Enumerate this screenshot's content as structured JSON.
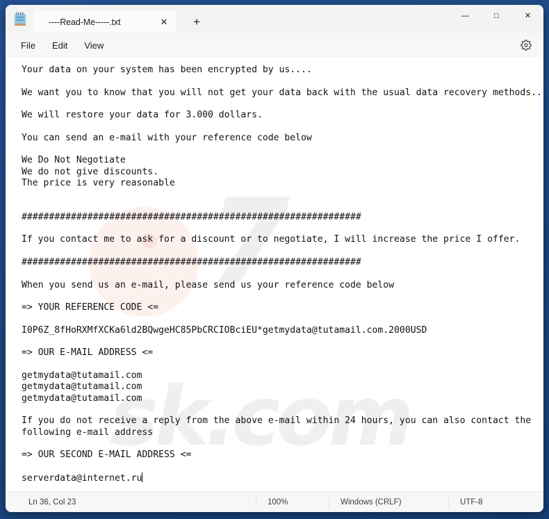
{
  "window": {
    "app_icon": "notepad-icon",
    "controls": {
      "minimize": "—",
      "maximize": "□",
      "close": "✕"
    }
  },
  "tab": {
    "title": "----Read-Me-----.txt",
    "close_glyph": "✕",
    "new_tab_glyph": "+"
  },
  "menubar": {
    "items": [
      {
        "label": "File"
      },
      {
        "label": "Edit"
      },
      {
        "label": "View"
      }
    ],
    "settings_icon": "gear-icon"
  },
  "document": {
    "body": "Your data on your system has been encrypted by us....\n\nWe want you to know that you will not get your data back with the usual data recovery methods...\n\nWe will restore your data for 3.000 dollars.\n\nYou can send an e-mail with your reference code below\n\nWe Do Not Negotiate\nWe do not give discounts.\nThe price is very reasonable\n\n\n##############################################################\n\nIf you contact me to ask for a discount or to negotiate, I will increase the price I offer.\n\n##############################################################\n\nWhen you send us an e-mail, please send us your reference code below\n\n=> YOUR REFERENCE CODE <=\n\nI0P6Z_8fHoRXMfXCKa6ld2BQwgeHC85PbCRCIOBciEU*getmydata@tutamail.com.2000USD\n\n=> OUR E-MAIL ADDRESS <=\n\ngetmydata@tutamail.com\ngetmydata@tutamail.com\ngetmydata@tutamail.com\n\nIf you do not receive a reply from the above e-mail within 24 hours, you can also contact the\nfollowing e-mail address\n\n=> OUR SECOND E-MAIL ADDRESS <=\n\nserverdata@internet.ru"
  },
  "watermark": {
    "line1": "7",
    "line2": "sk.com"
  },
  "statusbar": {
    "position": "Ln 36, Col 23",
    "zoom": "100%",
    "line_ending": "Windows (CRLF)",
    "encoding": "UTF-8"
  }
}
